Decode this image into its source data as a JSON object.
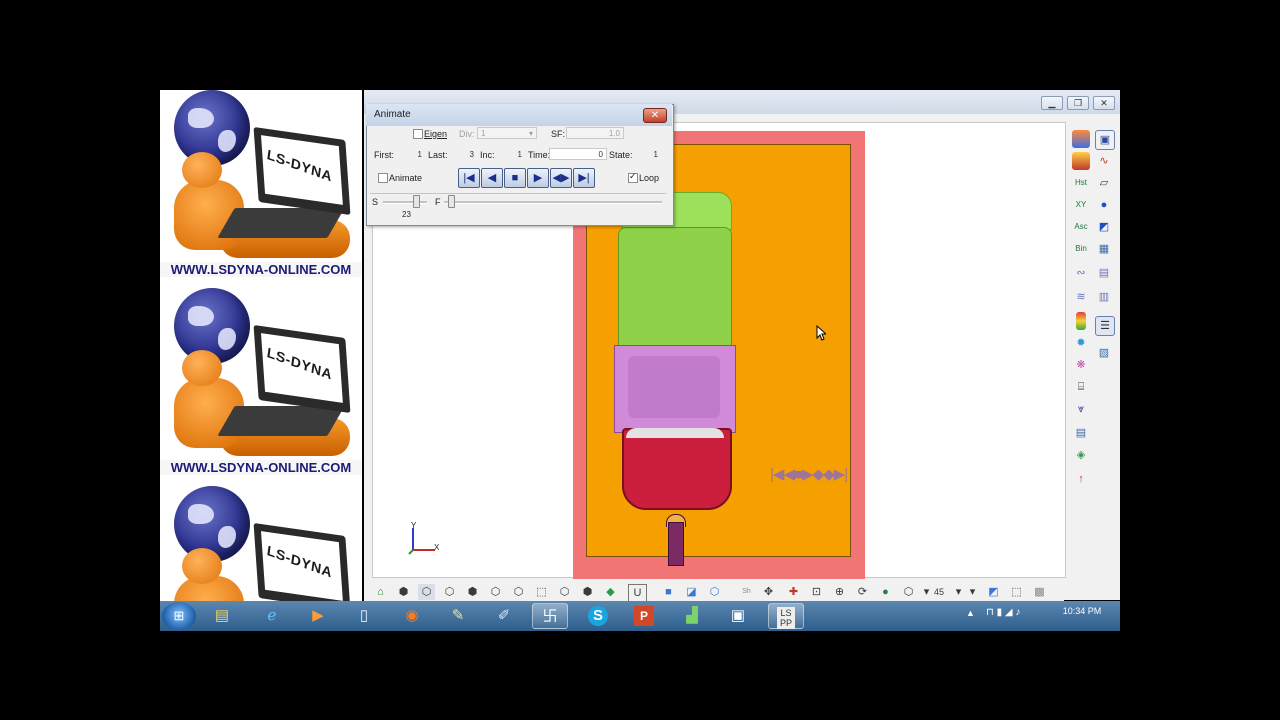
{
  "promo": {
    "laptop_text": "LS-DYNA",
    "url": "WWW.LSDYNA-ONLINE.COM"
  },
  "animate_dialog": {
    "title": "Animate",
    "close": "✕",
    "eigen_label": "Eigen",
    "eigen_checked": false,
    "div_label": "Div:",
    "div_value": "1",
    "sf_label": "SF:",
    "sf_value": "1.0",
    "first_label": "First:",
    "first_value": "1",
    "last_label": "Last:",
    "last_value": "3",
    "inc_label": "Inc:",
    "inc_value": "1",
    "time_label": "Time:",
    "time_value": "0",
    "state_label": "State:",
    "state_value": "1",
    "animate_label": "Animate",
    "animate_checked": false,
    "loop_label": "Loop",
    "loop_checked": true,
    "buttons": [
      "first-frame",
      "step-back",
      "stop",
      "play",
      "ping-pong",
      "last-frame"
    ],
    "slow_label": "S",
    "fast_label": "F",
    "speed_value": "23"
  },
  "viewport": {
    "axis_y": "Y",
    "axis_x": "X",
    "colors": {
      "border_frame": "#f17575",
      "ground": "#f5a000",
      "hood": "#8fd24a",
      "cabin": "#d08ad8",
      "bed": "#cc1f3d"
    }
  },
  "window_buttons": [
    "minimize",
    "restore",
    "close"
  ],
  "right_toolbar": [
    "view-cube-icon",
    "model-icon",
    "curve-icon",
    "history-icon",
    "xy-plot-icon",
    "ascii-icon",
    "binout-icon",
    "fringe-icon",
    "plane-icon",
    "mesh-icon",
    "measure-icon",
    "color-bar-icon",
    "group-icon",
    "select-icon",
    "blank-icon",
    "vector-icon",
    "trace-icon",
    "sph-icon",
    "deform-icon",
    "setting-icon"
  ],
  "bottom_toolbar": {
    "angle_value": "45"
  },
  "taskbar": {
    "items": [
      "explorer-icon",
      "ie-icon",
      "media-player-icon",
      "document-icon",
      "firefox-icon",
      "notepad-icon",
      "paint-icon",
      "lspp-logo-icon",
      "skype-icon",
      "powerpoint-icon",
      "chart-app-icon",
      "window-icon",
      "ls-prepost-icon"
    ],
    "ls_pp_label": "LS\nPP",
    "time": "10:34 PM"
  }
}
